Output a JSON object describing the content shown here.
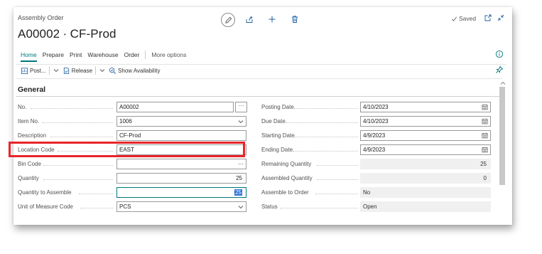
{
  "page": {
    "breadcrumb": "Assembly Order",
    "title": "A00002 ∙ CF-Prod",
    "saved_label": "Saved",
    "assist_button_label": "···"
  },
  "top_icons": [
    "pencil-edit-icon",
    "share-icon",
    "plus-icon",
    "delete-icon"
  ],
  "window_icons": [
    "open-in-new-window-icon",
    "collapse-icon"
  ],
  "menu": {
    "items": [
      "Home",
      "Prepare",
      "Print",
      "Warehouse",
      "Order"
    ],
    "more": "More options"
  },
  "toolbar": {
    "post_label": "Post...",
    "release_label": "Release",
    "availability_label": "Show Availability"
  },
  "section": {
    "title": "General"
  },
  "left_fields": [
    {
      "label": "No.",
      "value": "A00002",
      "kind": "input-assist"
    },
    {
      "label": "Item No.",
      "value": "1006",
      "kind": "dropdown"
    },
    {
      "label": "Description",
      "value": "CF-Prod",
      "kind": "input"
    },
    {
      "label": "Location Code",
      "value": "EAST",
      "kind": "input"
    },
    {
      "label": "Bin Code",
      "value": "",
      "kind": "lookup"
    },
    {
      "label": "Quantity",
      "value": "25",
      "kind": "number"
    },
    {
      "label": "Quantity to Assemble",
      "value": "25",
      "kind": "number-focused"
    },
    {
      "label": "Unit of Measure Code",
      "value": "PCS",
      "kind": "dropdown"
    }
  ],
  "right_fields": [
    {
      "label": "Posting Date",
      "value": "4/10/2023",
      "kind": "date"
    },
    {
      "label": "Due Date",
      "value": "4/10/2023",
      "kind": "date"
    },
    {
      "label": "Starting Date",
      "value": "4/9/2023",
      "kind": "date"
    },
    {
      "label": "Ending Date",
      "value": "4/9/2023",
      "kind": "date"
    },
    {
      "label": "Remaining Quantity",
      "value": "25",
      "kind": "readonly-number"
    },
    {
      "label": "Assembled Quantity",
      "value": "0",
      "kind": "readonly-number"
    },
    {
      "label": "Assemble to Order",
      "value": "No",
      "kind": "readonly"
    },
    {
      "label": "Status",
      "value": "Open",
      "kind": "readonly"
    }
  ],
  "colors": {
    "accent": "#00787a",
    "highlight": "#e8252a",
    "selection": "#2e71d9"
  }
}
